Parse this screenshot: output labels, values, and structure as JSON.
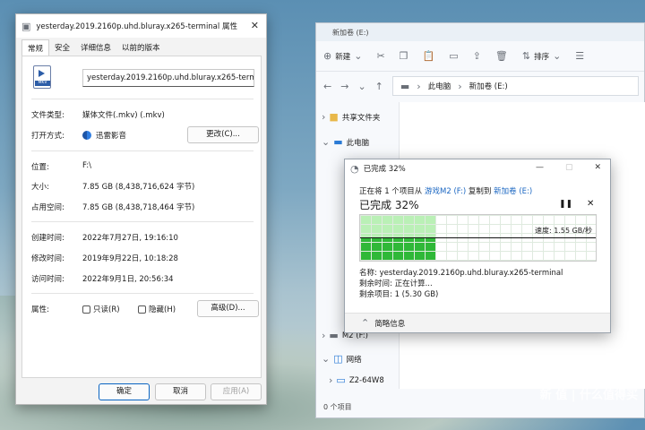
{
  "props": {
    "title": "yesterday.2019.2160p.uhd.bluray.x265-terminal 属性",
    "tabs": [
      "常规",
      "安全",
      "详细信息",
      "以前的版本"
    ],
    "icon_label": "MKV",
    "filename": "yesterday.2019.2160p.uhd.bluray.x265-terminal",
    "labels": {
      "type": "文件类型:",
      "open_with": "打开方式:",
      "location": "位置:",
      "size": "大小:",
      "size_on_disk": "占用空间:",
      "created": "创建时间:",
      "modified": "修改时间:",
      "accessed": "访问时间:",
      "attributes": "属性:"
    },
    "values": {
      "type": "媒体文件(.mkv) (.mkv)",
      "open_with": "迅雷影音",
      "location": "F:\\",
      "size": "7.85 GB (8,438,716,624 字节)",
      "size_on_disk": "7.85 GB (8,438,718,464 字节)",
      "created": "2022年7月27日, 19:16:10",
      "modified": "2019年9月22日, 10:18:28",
      "accessed": "2022年9月1日, 20:56:34"
    },
    "change_button": "更改(C)...",
    "readonly": "只读(R)",
    "hidden": "隐藏(H)",
    "advanced_button": "高级(D)...",
    "ok": "确定",
    "cancel": "取消",
    "apply": "应用(A)"
  },
  "explorer": {
    "title": "新加卷 (E:)",
    "new": "新建",
    "sort": "排序",
    "view": "查看",
    "path": [
      "此电脑",
      "新加卷 (E:)"
    ],
    "nav": [
      "共享文件夹",
      "此电脑",
      "M2 (F:)",
      "网络",
      "Z2-64W8"
    ],
    "status": "0 个项目"
  },
  "copy": {
    "title": "已完成 32%",
    "line_prefix": "正在将 1 个项目从",
    "src": "游戏M2 (F:)",
    "mid": "复制到",
    "dst": "新加卷 (E:)",
    "percent_text": "已完成 32%",
    "progress": 0.32,
    "speed": "速度: 1.55 GB/秒",
    "name_line": "名称: yesterday.2019.2160p.uhd.bluray.x265-terminal",
    "time_left": "剩余时间: 正在计算...",
    "items_left": "剩余项目: 1 (5.30 GB)",
    "less_details": "简略信息"
  },
  "watermark": "新 值 | 什么值得买"
}
